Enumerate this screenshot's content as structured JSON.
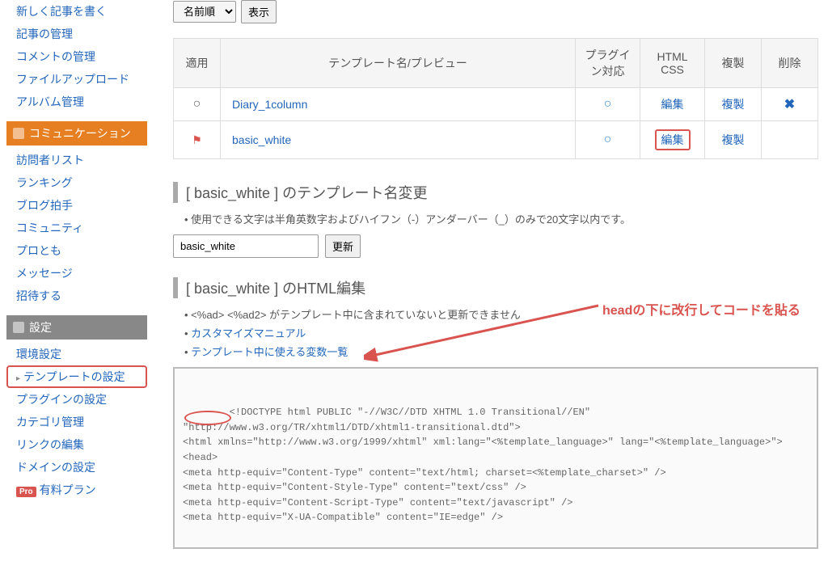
{
  "sidebar": {
    "group_top": [
      "新しく記事を書く",
      "記事の管理",
      "コメントの管理",
      "ファイルアップロード",
      "アルバム管理"
    ],
    "section_comm_title": "コミュニケーション",
    "group_comm": [
      "訪問者リスト",
      "ランキング",
      "ブログ拍手",
      "コミュニティ",
      "プロとも",
      "メッセージ",
      "招待する"
    ],
    "section_settings_title": "設定",
    "group_settings": [
      "環境設定",
      "テンプレートの設定",
      "プラグインの設定",
      "カテゴリ管理",
      "リンクの編集",
      "ドメインの設定"
    ],
    "pro_label": "Pro",
    "pro_text": "有料プラン"
  },
  "controls": {
    "sort_selected": "名前順",
    "show_button": "表示"
  },
  "table": {
    "headers": {
      "apply": "適用",
      "name": "テンプレート名/プレビュー",
      "plugin": "プラグイン対応",
      "htmlcss": "HTML\nCSS",
      "dup": "複製",
      "del": "削除"
    },
    "rows": [
      {
        "apply": "○",
        "name": "Diary_1column",
        "plugin": "○",
        "edit": "編集",
        "dup": "複製",
        "del": "✖",
        "flag": false,
        "highlight": false
      },
      {
        "apply": "⚑",
        "name": "basic_white",
        "plugin": "○",
        "edit": "編集",
        "dup": "複製",
        "del": "",
        "flag": true,
        "highlight": true
      }
    ]
  },
  "rename": {
    "title_prefix": "[ ",
    "title_name": "basic_white",
    "title_suffix": " ] のテンプレート名変更",
    "note": "使用できる文字は半角英数字およびハイフン（-）アンダーバー（_）のみで20文字以内です。",
    "input_value": "basic_white",
    "update_btn": "更新"
  },
  "htmledit": {
    "title_prefix": "[ ",
    "title_name": "basic_white",
    "title_suffix": " ] のHTML編集",
    "note1_a": "<%ad> <%ad2>",
    "note1_b": " がテンプレート中に含まれていないと更新できません",
    "note2": "カスタマイズマニュアル",
    "note3": "テンプレート中に使える変数一覧",
    "code": "<!DOCTYPE html PUBLIC \"-//W3C//DTD XHTML 1.0 Transitional//EN\" \"http://www.w3.org/TR/xhtml1/DTD/xhtml1-transitional.dtd\">\n<html xmlns=\"http://www.w3.org/1999/xhtml\" xml:lang=\"<%template_language>\" lang=\"<%template_language>\">\n<head>\n<meta http-equiv=\"Content-Type\" content=\"text/html; charset=<%template_charset>\" />\n<meta http-equiv=\"Content-Style-Type\" content=\"text/css\" />\n<meta http-equiv=\"Content-Script-Type\" content=\"text/javascript\" />\n<meta http-equiv=\"X-UA-Compatible\" content=\"IE=edge\" />"
  },
  "annotation": "headの下に改行してコードを貼る"
}
